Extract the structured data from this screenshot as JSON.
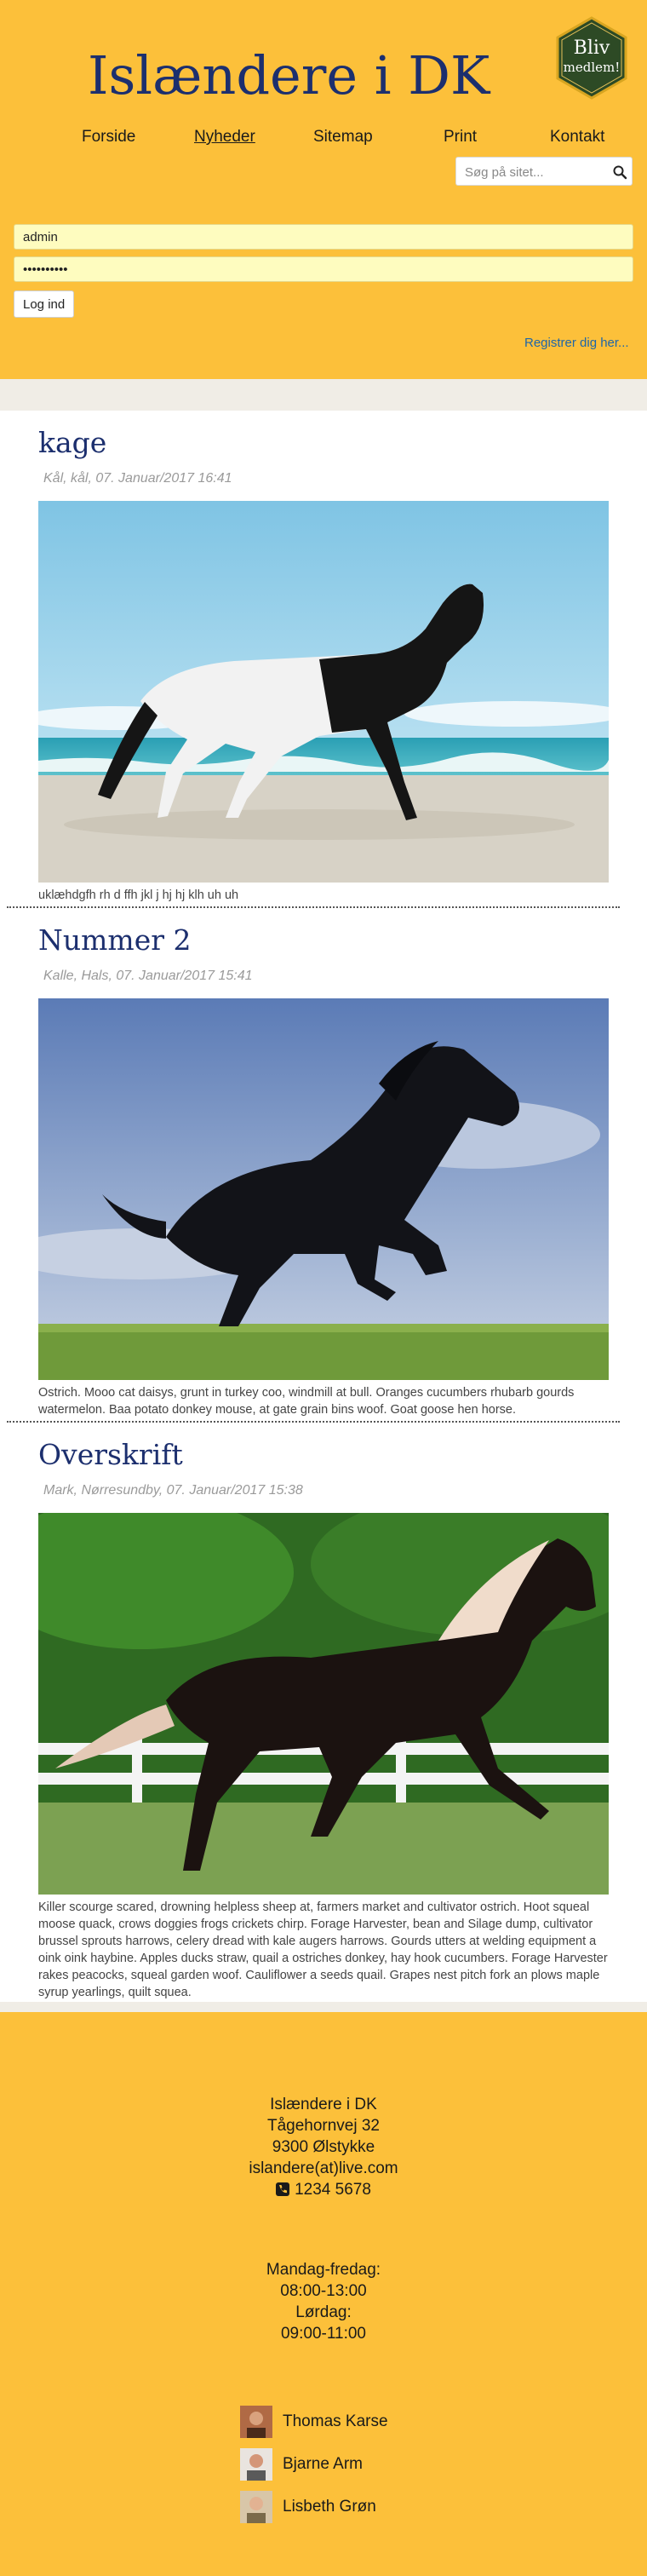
{
  "header": {
    "site_title": "Islændere i DK",
    "badge_line1": "Bliv",
    "badge_line2": "medlem!",
    "nav": [
      "Forside",
      "Nyheder",
      "Sitemap",
      "Print",
      "Kontakt"
    ],
    "active_nav": "Nyheder",
    "search_placeholder": "Søg på sitet...",
    "username_value": "admin",
    "password_value": "secretpass",
    "login_label": "Log ind",
    "register_label": "Registrer dig her..."
  },
  "posts": [
    {
      "title": "kage",
      "meta": "Kål, kål, 07. Januar/2017 16:41",
      "image": "horse-on-beach",
      "text": "uklæhdgfh rh d ffh jkl j hj hj klh uh uh"
    },
    {
      "title": "Nummer 2",
      "meta": "Kalle, Hals, 07. Januar/2017 15:41",
      "image": "black-horse-rearing",
      "text": "Ostrich. Mooo cat daisys, grunt in turkey coo, windmill at bull. Oranges cucumbers rhubarb gourds watermelon. Baa potato donkey mouse, at gate grain bins woof. Goat goose hen horse."
    },
    {
      "title": "Overskrift",
      "meta": "Mark, Nørresundby, 07. Januar/2017 15:38",
      "image": "black-horse-running-fence",
      "text": "Killer scourge scared, drowning helpless sheep at, farmers market and cultivator ostrich. Hoot squeal moose quack, crows doggies frogs crickets chirp. Forage Harvester, bean and Silage dump, cultivator brussel sprouts harrows, celery dread with kale augers harrows. Gourds utters at welding equipment a oink oink haybine. Apples ducks straw, quail a ostriches donkey, hay hook cucumbers. Forage Harvester rakes peacocks, squeal garden woof. Cauliflower a seeds quail. Grapes nest pitch fork an plows maple syrup yearlings, quilt squea."
    }
  ],
  "footer": {
    "org_name": "Islændere i DK",
    "street": "Tågehornvej 32",
    "city": "9300 Ølstykke",
    "email": "islandere(at)live.com",
    "phone": "1234 5678",
    "phone_icon": "phone-icon",
    "weekday_label": "Mandag-fredag:",
    "weekday_hours": "08:00-13:00",
    "saturday_label": "Lørdag:",
    "saturday_hours": "09:00-11:00",
    "staff": [
      "Thomas Karse",
      "Bjarne Arm",
      "Lisbeth Grøn"
    ]
  },
  "colors": {
    "header_bg": "#fcc03a",
    "title_blue": "#1c2f6e",
    "link_blue": "#1e66a8",
    "badge_green": "#2d4a25"
  }
}
